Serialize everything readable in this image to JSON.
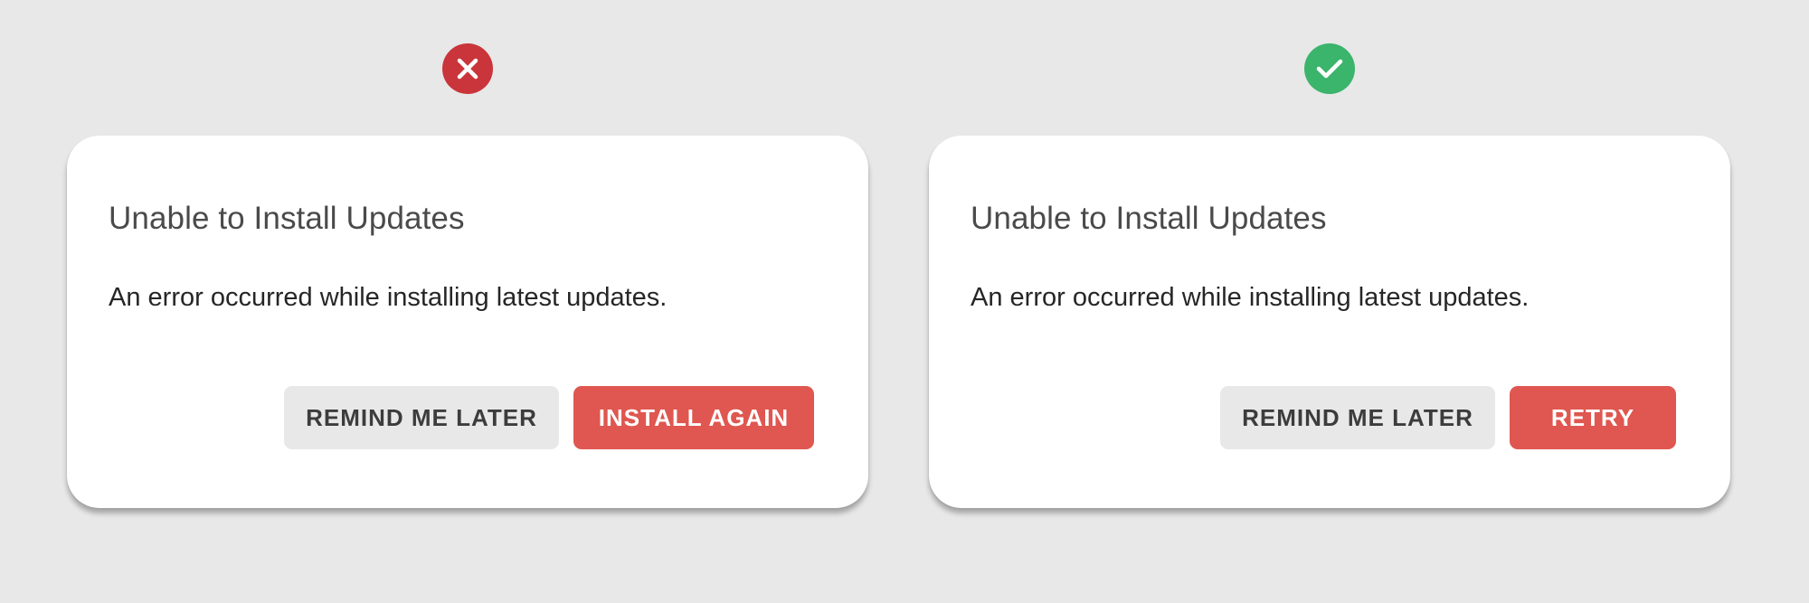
{
  "examples": [
    {
      "verdict_icon": "cross-icon",
      "verdict_color": "#c9353a",
      "dialog": {
        "title": "Unable to Install Updates",
        "message": "An error occurred while installing latest updates.",
        "secondary_button": "REMIND ME LATER",
        "primary_button": "INSTALL AGAIN"
      }
    },
    {
      "verdict_icon": "checkmark-icon",
      "verdict_color": "#3bb46c",
      "dialog": {
        "title": "Unable to Install Updates",
        "message": "An error occurred while installing latest updates.",
        "secondary_button": "REMIND ME LATER",
        "primary_button": "RETRY"
      }
    }
  ],
  "colors": {
    "background": "#e8e8e8",
    "dialog": "#ffffff",
    "primary_button": "#df5750",
    "secondary_button": "#e8e8e8"
  }
}
